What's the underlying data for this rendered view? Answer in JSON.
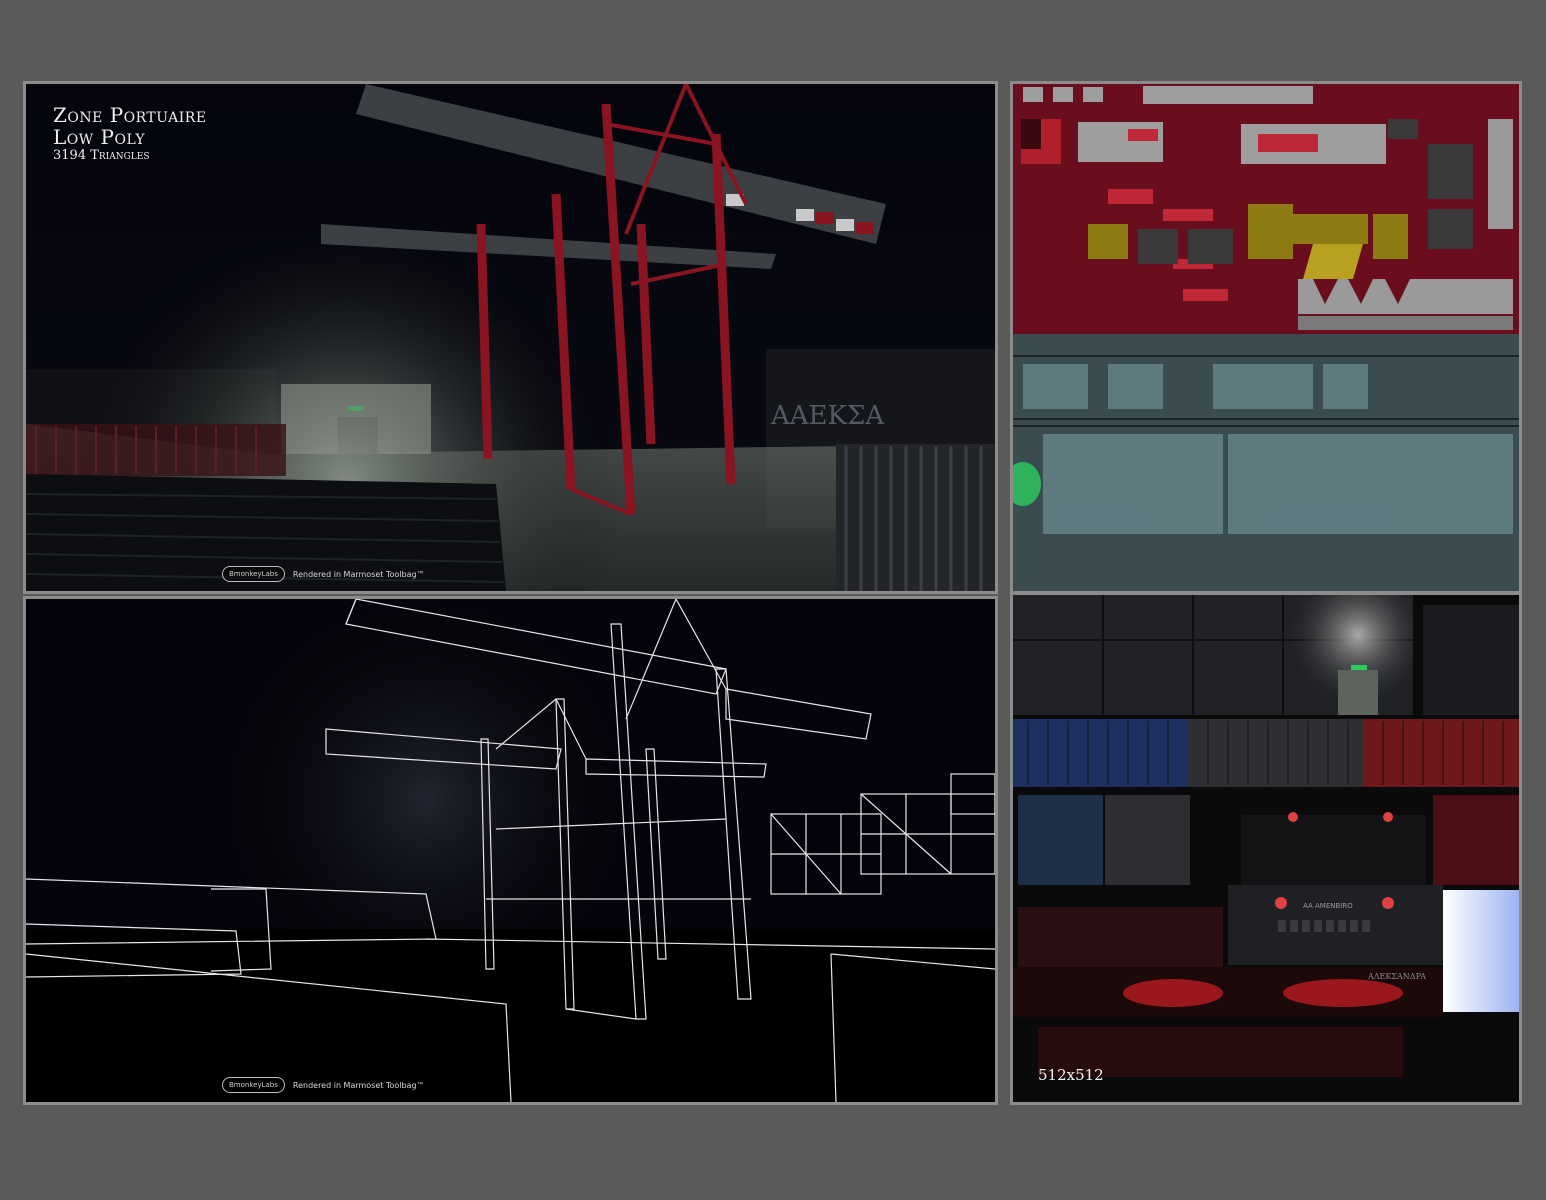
{
  "render": {
    "title_line1": "Zone Portuaire",
    "title_line2": "Low Poly",
    "triangles": "3194 Triangles",
    "logo_text": "BmonkeyLabs",
    "credit_text": "Rendered in Marmoset Toolbag™",
    "sign_text": "AAEKΣA"
  },
  "wireframe": {
    "logo_text": "BmonkeyLabs",
    "credit_text": "Rendered in Marmoset Toolbag™"
  },
  "textures": {
    "resolution_label": "512x512",
    "ship_name": "AΛEKΣANΔPA",
    "ship_plate": "AA AMENBIRO"
  },
  "colors": {
    "background": "#5a5a5a",
    "frame": "#8c8c8c",
    "crane_red": "#8a1420",
    "texture_red": "#6a0d1c",
    "wire_white": "#e6e6e6",
    "exit_green": "#2ecc60"
  }
}
